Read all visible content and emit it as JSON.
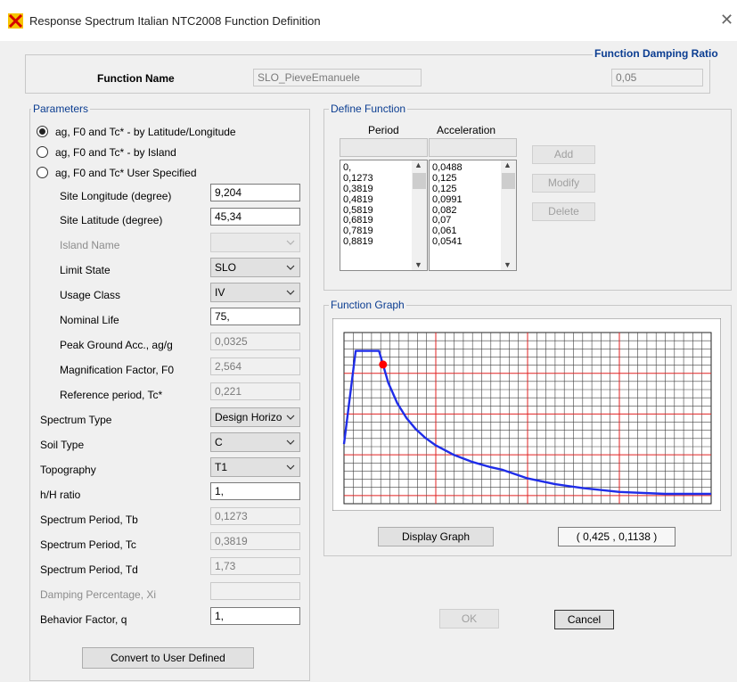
{
  "window": {
    "title": "Response Spectrum Italian NTC2008 Function Definition"
  },
  "function_name": {
    "label": "Function Name",
    "value": "SLO_PieveEmanuele"
  },
  "damping": {
    "label": "Function Damping Ratio",
    "value": "0,05"
  },
  "parameters": {
    "group_label": "Parameters",
    "radios": [
      {
        "label": "ag, F0 and Tc* - by Latitude/Longitude",
        "selected": true
      },
      {
        "label": "ag, F0 and Tc* - by Island",
        "selected": false
      },
      {
        "label": "ag, F0 and Tc* User Specified",
        "selected": false
      }
    ],
    "site_longitude": {
      "label": "Site Longitude (degree)",
      "value": "9,204"
    },
    "site_latitude": {
      "label": "Site Latitude (degree)",
      "value": "45,34"
    },
    "island_name": {
      "label": "Island Name",
      "value": ""
    },
    "limit_state": {
      "label": "Limit State",
      "value": "SLO"
    },
    "usage_class": {
      "label": "Usage Class",
      "value": "IV"
    },
    "nominal_life": {
      "label": "Nominal Life",
      "value": "75,"
    },
    "peak_ground_acc": {
      "label": "Peak Ground Acc., ag/g",
      "value": "0,0325"
    },
    "magnification_factor": {
      "label": "Magnification Factor, F0",
      "value": "2,564"
    },
    "reference_period": {
      "label": "Reference period, Tc*",
      "value": "0,221"
    },
    "spectrum_type": {
      "label": "Spectrum Type",
      "value": "Design Horizo"
    },
    "soil_type": {
      "label": "Soil Type",
      "value": "C"
    },
    "topography": {
      "label": "Topography",
      "value": "T1"
    },
    "hH_ratio": {
      "label": "h/H ratio",
      "value": "1,"
    },
    "spectrum_tb": {
      "label": "Spectrum Period, Tb",
      "value": "0,1273"
    },
    "spectrum_tc": {
      "label": "Spectrum Period, Tc",
      "value": "0,3819"
    },
    "spectrum_td": {
      "label": "Spectrum Period, Td",
      "value": "1,73"
    },
    "damping_xi": {
      "label": "Damping Percentage, Xi",
      "value": ""
    },
    "behavior_factor": {
      "label": "Behavior Factor, q",
      "value": "1,"
    },
    "convert_button": "Convert to User Defined"
  },
  "define_function": {
    "group_label": "Define Function",
    "period_header": "Period",
    "acceleration_header": "Acceleration",
    "periods": [
      "0,",
      "0,1273",
      "0,3819",
      "0,4819",
      "0,5819",
      "0,6819",
      "0,7819",
      "0,8819"
    ],
    "accelerations": [
      "0,0488",
      "0,125",
      "0,125",
      "0,0991",
      "0,082",
      "0,07",
      "0,061",
      "0,0541"
    ],
    "add_button": "Add",
    "modify_button": "Modify",
    "delete_button": "Delete"
  },
  "function_graph": {
    "group_label": "Function Graph",
    "display_button": "Display Graph",
    "coordinate_readout": "( 0,425  ,  0,1138 )"
  },
  "ok_button": "OK",
  "cancel_button": "Cancel",
  "chart_data": {
    "type": "line",
    "x": [
      0,
      0.1273,
      0.3819,
      0.4819,
      0.5819,
      0.6819,
      0.7819,
      0.8819,
      1.0,
      1.2,
      1.4,
      1.6,
      1.73,
      2.0,
      2.3,
      2.6,
      3.0,
      3.5,
      4.0
    ],
    "y": [
      0.0488,
      0.125,
      0.125,
      0.0991,
      0.082,
      0.07,
      0.061,
      0.0541,
      0.0477,
      0.0398,
      0.0341,
      0.0298,
      0.0276,
      0.0207,
      0.016,
      0.0128,
      0.0096,
      0.008,
      0.008
    ],
    "highlight_point": {
      "x": 0.425,
      "y": 0.1138
    },
    "xlim": [
      0,
      4.0
    ],
    "ylim": [
      0,
      0.14
    ],
    "grid": true,
    "series_color": "#1f2de8",
    "grid_major_color": "#e12222",
    "grid_minor_color": "#404040",
    "point_color": "#ff0000"
  },
  "colors": {
    "group_label": "#0b3d91",
    "graph_line": "#1f2de8",
    "grid_major": "#e12222"
  }
}
